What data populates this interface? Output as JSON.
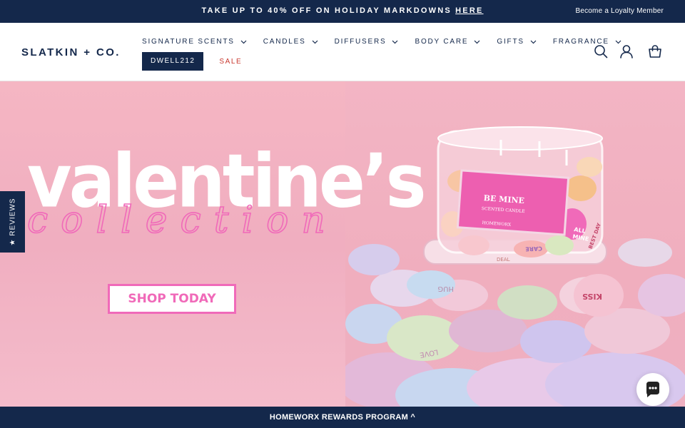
{
  "announcement": {
    "text": "TAKE UP TO 40% OFF ON HOLIDAY MARKDOWNS ",
    "link": "HERE",
    "loyalty": "Become a Loyalty Member"
  },
  "header": {
    "logo": "SLATKIN + CO.",
    "nav": [
      {
        "label": "SIGNATURE SCENTS"
      },
      {
        "label": "CANDLES"
      },
      {
        "label": "DIFFUSERS"
      },
      {
        "label": "BODY CARE"
      },
      {
        "label": "GIFTS"
      },
      {
        "label": "FRAGRANCE"
      }
    ],
    "promo_code": "DWELL212",
    "sale": "SALE",
    "icons": [
      "search-icon",
      "account-icon",
      "cart-icon"
    ]
  },
  "hero": {
    "title": "valentine’s",
    "script": "collection",
    "cta": "SHOP TODAY",
    "candle_label": {
      "line1": "BE MINE",
      "line2": "SCENTED CANDLE",
      "brand": "HOMEWORX"
    },
    "hearts": [
      "HUG",
      "LOVE",
      "KISS",
      "ALL MINE",
      "BEST DAY",
      "CARE",
      "DEAL"
    ]
  },
  "reviews_tab": "★ REVIEWS",
  "rewards_bar": "HOMEWORX REWARDS PROGRAM ^",
  "colors": {
    "navy": "#14284b",
    "pink": "#f06ab9",
    "sale_red": "#c8372d",
    "hero_bg": "#f3b5c4"
  }
}
